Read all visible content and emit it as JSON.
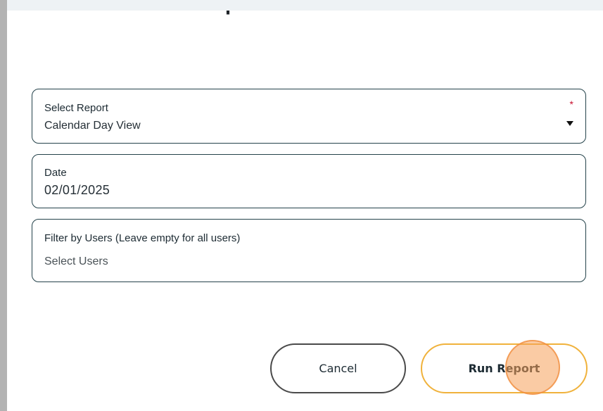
{
  "dialog": {
    "title": "Produce Report"
  },
  "form": {
    "report": {
      "label": "Select Report",
      "required_mark": "*",
      "value": "Calendar Day View"
    },
    "date": {
      "label": "Date",
      "value": "02/01/2025"
    },
    "users": {
      "label": "Filter by Users (Leave empty for all users)",
      "placeholder": "Select Users"
    }
  },
  "actions": {
    "cancel_label": "Cancel",
    "run_label": "Run Report"
  },
  "colors": {
    "accent": "#f0b23c",
    "field_border": "#24424a",
    "required": "#c8102e"
  }
}
